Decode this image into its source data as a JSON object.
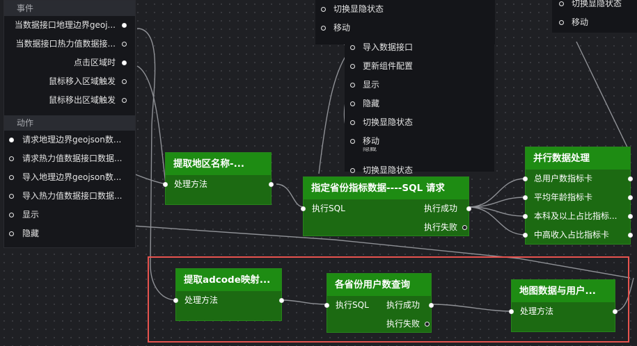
{
  "left_panel": {
    "events_header": "事件",
    "events": [
      "当数据接口地理边界geoj...",
      "当数据接口热力值数据接...",
      "点击区域时",
      "鼠标移入区域触发",
      "鼠标移出区域触发"
    ],
    "actions_header": "动作",
    "actions": [
      "请求地理边界geojson数...",
      "请求热力值数据接口数据...",
      "导入地理边界geojson数...",
      "导入热力值数据接口数据...",
      "显示",
      "隐藏"
    ]
  },
  "middle_top_panel": {
    "items_a": [
      "切换显隐状态",
      "移动"
    ],
    "items_b": [
      "导入数据接口",
      "更新组件配置",
      "显示",
      "隐藏",
      "切换显隐状态",
      "移动"
    ],
    "overlap_fragment": "隐藏",
    "bottom_item": "切换显隐状态"
  },
  "right_top_panel": {
    "items": [
      "切换显隐状态",
      "移动"
    ]
  },
  "nodes": {
    "extract_region_name": {
      "title": "提取地区名称-...",
      "port_in": "处理方法"
    },
    "province_sql": {
      "title": "指定省份指标数据----SQL 请求",
      "port_in": "执行SQL",
      "out_success": "执行成功",
      "out_fail": "执行失败"
    },
    "parallel": {
      "title": "并行数据处理",
      "outputs": [
        "总用户数指标卡",
        "平均年龄指标卡",
        "本科及以上占比指标...",
        "中高收入占比指标卡"
      ]
    },
    "extract_adcode": {
      "title": "提取adcode映射...",
      "port_in": "处理方法"
    },
    "province_users": {
      "title": "各省份用户数查询",
      "port_in": "执行SQL",
      "out_success": "执行成功",
      "out_fail": "执行失败"
    },
    "map_data": {
      "title": "地图数据与用户...",
      "port_in": "处理方法"
    }
  },
  "colors": {
    "canvas": "#1f2024",
    "node_body": "#1c6a12",
    "node_title": "#1e8c13",
    "wire": "#8f9196",
    "highlight": "#e8534f"
  }
}
